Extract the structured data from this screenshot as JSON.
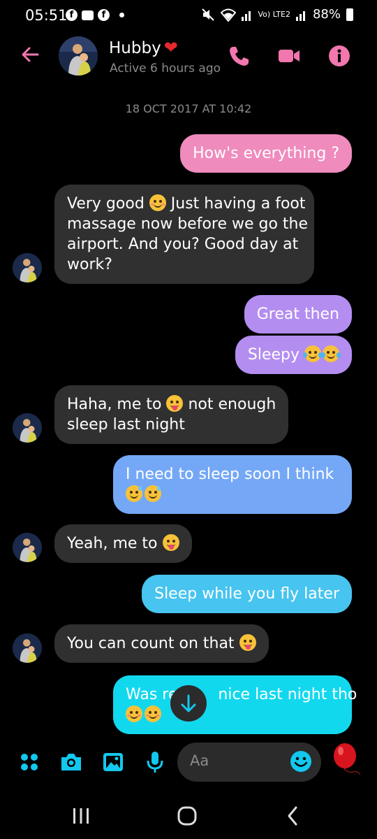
{
  "status_bar": {
    "time": "05:51",
    "network_label": "Vo) LTE2",
    "battery": "88%"
  },
  "header": {
    "contact_name": "Hubby",
    "status": "Active 6 hours ago"
  },
  "conversation": {
    "timestamp": "18 OCT 2017 AT 10:42",
    "messages": [
      {
        "sender": "me",
        "text": "How's everything ?",
        "color": "#ef8bbd"
      },
      {
        "sender": "them",
        "lines": [
          "Very good ",
          " Just having a foot",
          "massage now before we go the",
          "airport. And you? Good day at",
          "work?"
        ]
      },
      {
        "sender": "me",
        "text": "Great then",
        "color": "#b38ef0"
      },
      {
        "sender": "me",
        "text": "Sleepy ",
        "color": "#b38ef0"
      },
      {
        "sender": "them",
        "lines": [
          "Haha, me to ",
          " not enough",
          "sleep last night"
        ]
      },
      {
        "sender": "me",
        "text": "I need to sleep soon I think",
        "color": "#74a8f6"
      },
      {
        "sender": "them",
        "text": "Yeah, me to "
      },
      {
        "sender": "me",
        "text": "Sleep while you fly later",
        "color": "#47c4ef"
      },
      {
        "sender": "them",
        "text": "You can count on that "
      },
      {
        "sender": "me",
        "text_left": "Was re",
        "text_right": "nice last night tho",
        "color": "#12d8ee"
      }
    ]
  },
  "composer": {
    "placeholder": "Aa"
  },
  "colors": {
    "accent_pink": "#f177ae",
    "accent_cyan": "#12c8ee",
    "incoming_bubble": "#303030"
  }
}
